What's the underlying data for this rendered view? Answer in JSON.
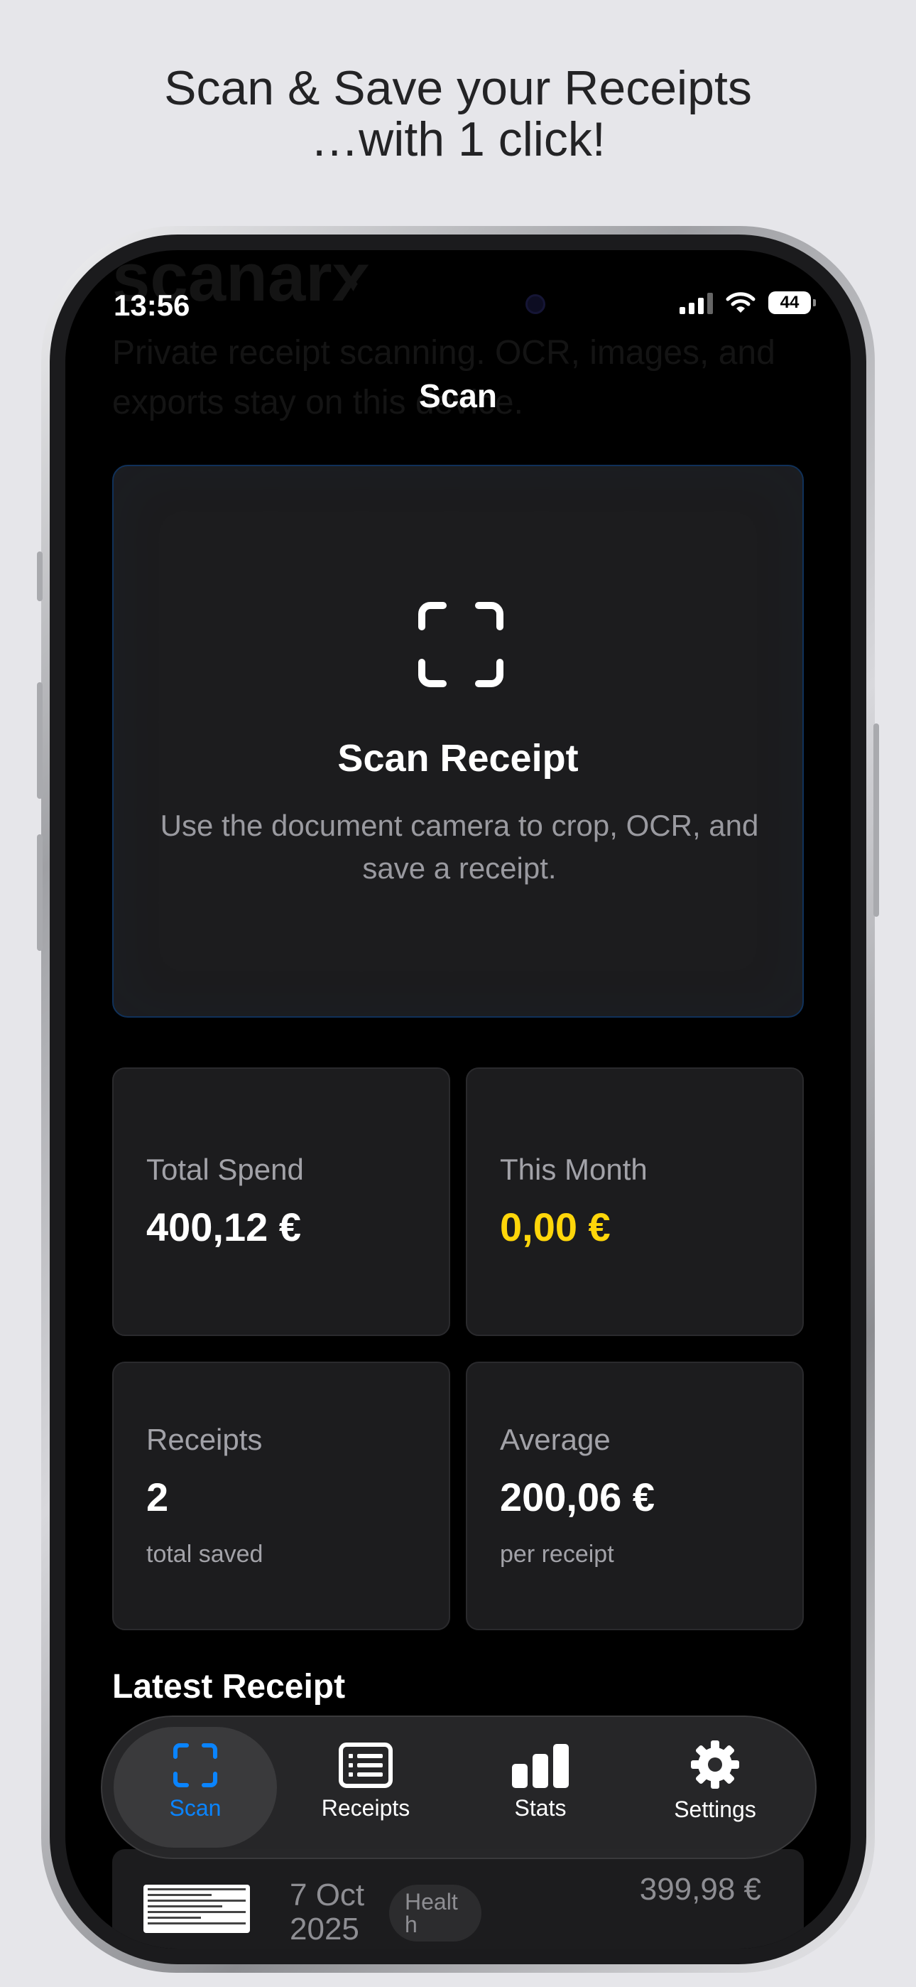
{
  "marketing": {
    "headline_line1": "Scan & Save your Receipts",
    "headline_line2": "…with 1 click!"
  },
  "background_app": {
    "brand": "scanarx",
    "tagline": "Private receipt scanning. OCR, images, and exports stay on this device."
  },
  "status_bar": {
    "time": "13:56",
    "battery": "44"
  },
  "nav": {
    "title": "Scan"
  },
  "scan_card": {
    "icon": "scan-frame-icon",
    "title": "Scan Receipt",
    "description": "Use the document camera to crop, OCR, and save a receipt."
  },
  "stats": {
    "total_spend": {
      "label": "Total Spend",
      "value": "400,12 €"
    },
    "this_month": {
      "label": "This Month",
      "value": "0,00 €"
    },
    "receipts": {
      "label": "Receipts",
      "value": "2",
      "sub": "total saved"
    },
    "average": {
      "label": "Average",
      "value": "200,06 €",
      "sub": "per receipt"
    }
  },
  "latest_receipt": {
    "section_title": "Latest Receipt",
    "date_line1": "7 Oct",
    "date_line2": "2025",
    "category": "Healt h",
    "amount": "399,98 €"
  },
  "tabbar": {
    "tabs": [
      {
        "label": "Scan",
        "icon": "scan-frame-icon",
        "active": true
      },
      {
        "label": "Receipts",
        "icon": "list-icon",
        "active": false
      },
      {
        "label": "Stats",
        "icon": "bar-chart-icon",
        "active": false
      },
      {
        "label": "Settings",
        "icon": "gear-icon",
        "active": false
      }
    ]
  },
  "colors": {
    "accent": "#0a84ff",
    "highlight": "#ffd60a",
    "card": "#1c1c1e",
    "background": "#000000"
  }
}
